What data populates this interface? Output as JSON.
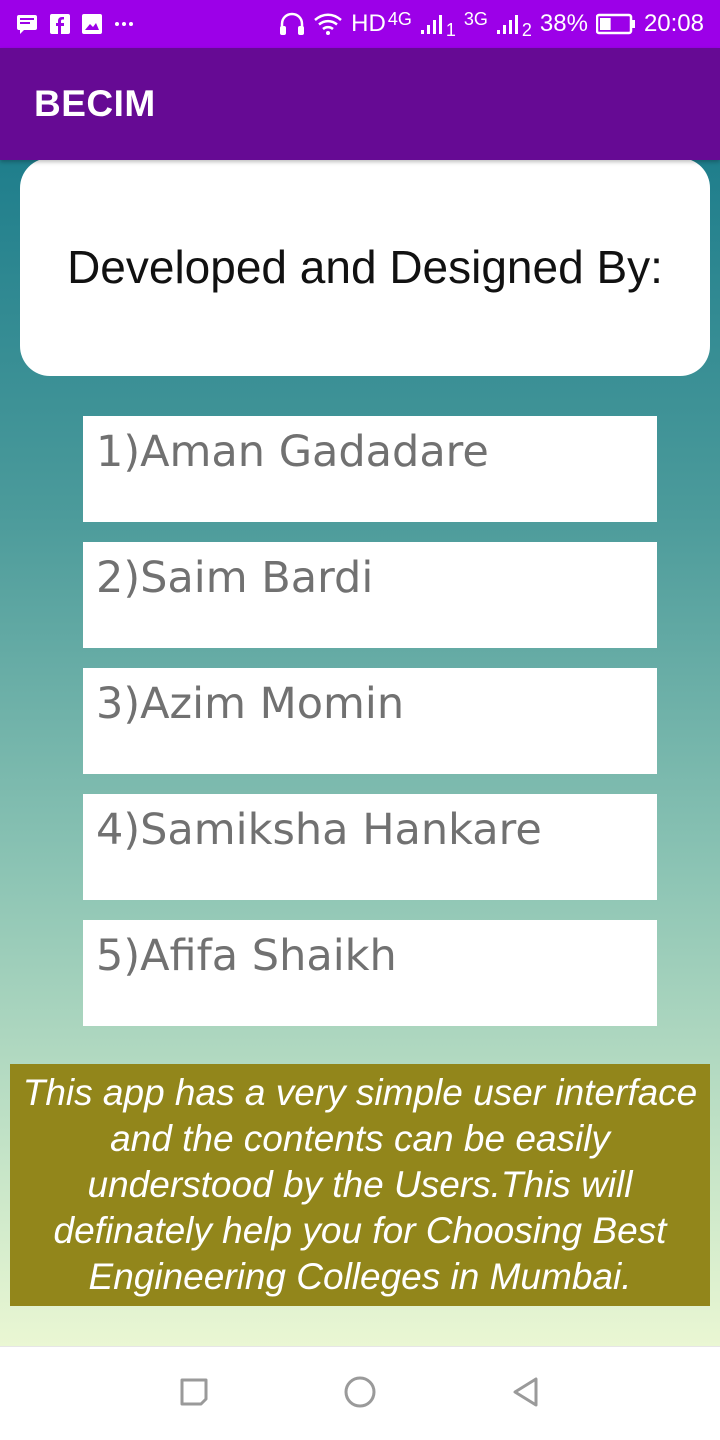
{
  "status_bar": {
    "network_label": "HD",
    "net_4g": "4G",
    "sim1": "1",
    "net_3g": "3G",
    "sim2": "2",
    "battery_percent": "38%",
    "time": "20:08",
    "battery_level": 0.38,
    "icons": [
      "message-icon",
      "facebook-icon",
      "image-icon",
      "more-icon",
      "headphones-icon",
      "wifi-icon",
      "signal-icon",
      "battery-icon"
    ]
  },
  "app_bar": {
    "title": "BECIM"
  },
  "header": {
    "text": "Developed and Designed By:"
  },
  "developers": [
    {
      "label": "1)Aman Gadadare"
    },
    {
      "label": "2)Saim Bardi"
    },
    {
      "label": "3)Azim Momin"
    },
    {
      "label": "4)Samiksha Hankare"
    },
    {
      "label": "5)Afifa Shaikh"
    }
  ],
  "about": {
    "text": "This app has a very simple user interface and the contents can be easily understood by the Users.This will definately help you for Choosing Best Engineering Colleges in Mumbai."
  },
  "nav": {
    "buttons": [
      "recent-apps-icon",
      "home-icon",
      "back-icon"
    ]
  },
  "colors": {
    "status_bar": "#9c00e8",
    "app_bar": "#660a94",
    "about_box": "#92861b",
    "gradient_top": "#1f7e8c",
    "gradient_bottom": "#eaf7d3"
  }
}
